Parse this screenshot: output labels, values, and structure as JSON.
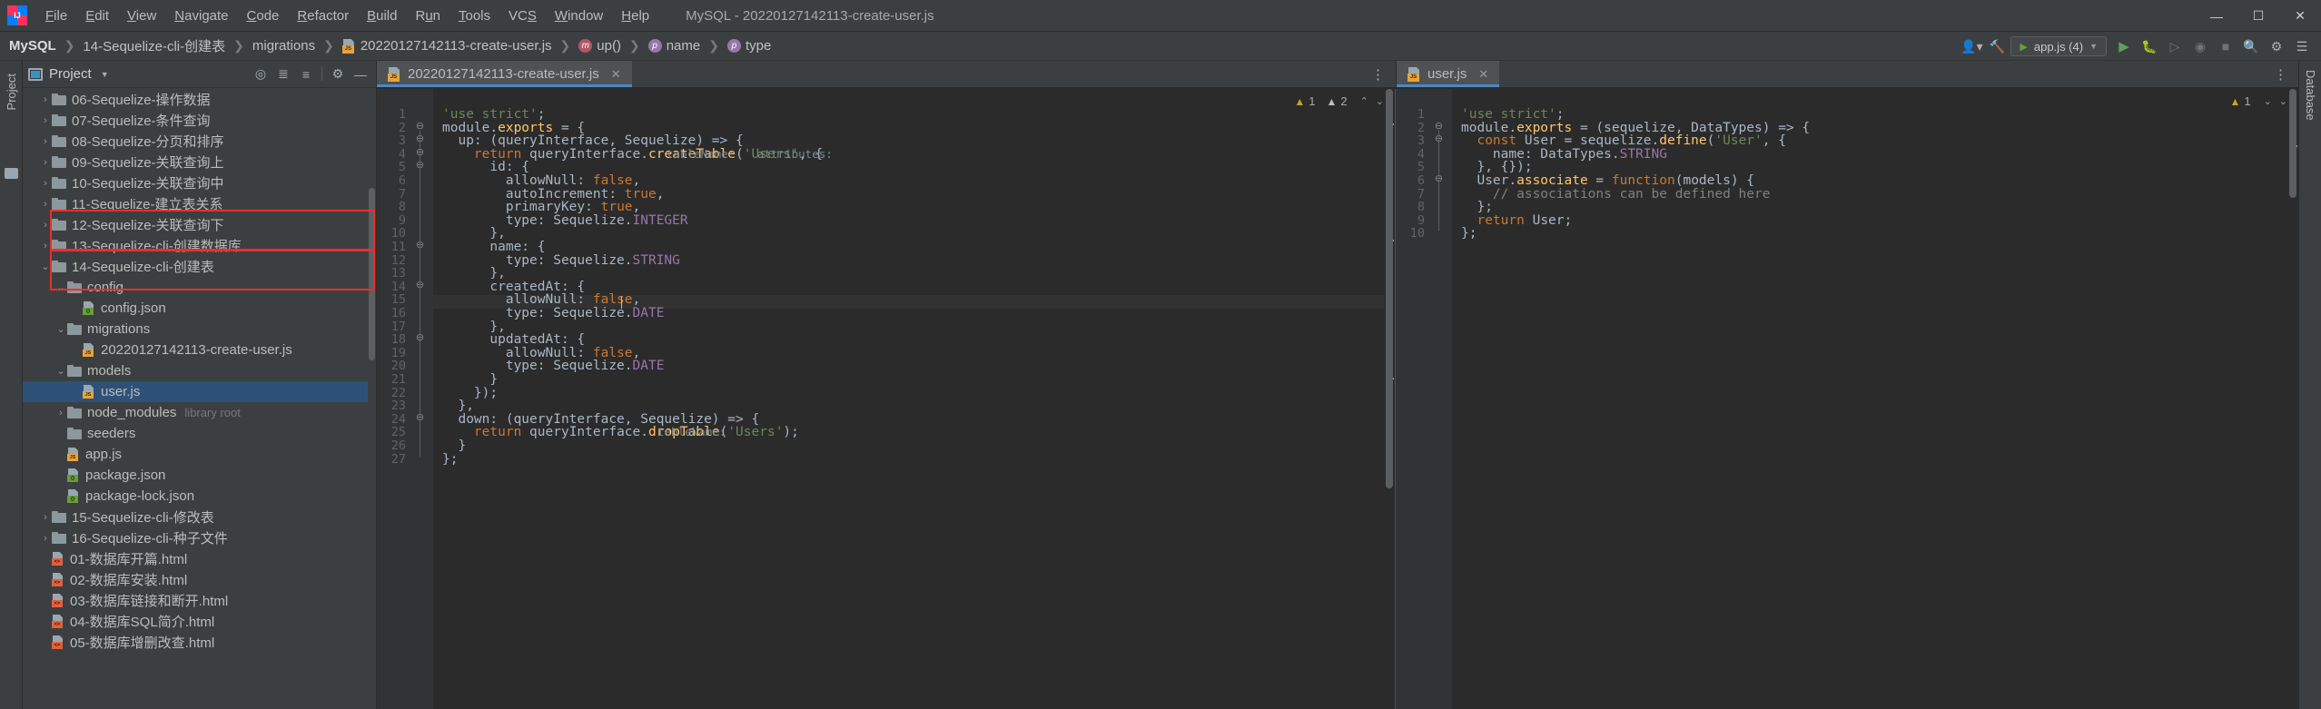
{
  "window": {
    "title": "MySQL - 20220127142113-create-user.js",
    "minimize": "—",
    "maximize": "☐",
    "close": "✕"
  },
  "menubar": {
    "logo_text": "IJ",
    "items": [
      {
        "pre": "",
        "mn": "F",
        "post": "ile"
      },
      {
        "pre": "",
        "mn": "E",
        "post": "dit"
      },
      {
        "pre": "",
        "mn": "V",
        "post": "iew"
      },
      {
        "pre": "",
        "mn": "N",
        "post": "avigate"
      },
      {
        "pre": "",
        "mn": "C",
        "post": "ode"
      },
      {
        "pre": "",
        "mn": "R",
        "post": "efactor"
      },
      {
        "pre": "",
        "mn": "B",
        "post": "uild"
      },
      {
        "pre": "R",
        "mn": "u",
        "post": "n"
      },
      {
        "pre": "",
        "mn": "T",
        "post": "ools"
      },
      {
        "pre": "VC",
        "mn": "S",
        "post": ""
      },
      {
        "pre": "",
        "mn": "W",
        "post": "indow"
      },
      {
        "pre": "",
        "mn": "H",
        "post": "elp"
      }
    ]
  },
  "breadcrumb": {
    "separator": "❯",
    "items": [
      {
        "label": "MySQL",
        "icon": "none",
        "root": true
      },
      {
        "label": "14-Sequelize-cli-创建表",
        "icon": "none"
      },
      {
        "label": "migrations",
        "icon": "none"
      },
      {
        "label": "20220127142113-create-user.js",
        "icon": "js-file-icon",
        "badge": "JS"
      },
      {
        "label": "up()",
        "icon": "method-icon",
        "badge": "m"
      },
      {
        "label": "name",
        "icon": "property-icon",
        "badge": "p"
      },
      {
        "label": "type",
        "icon": "property-icon",
        "badge": "p"
      }
    ]
  },
  "nav_right": {
    "run_config": "app.js (4)",
    "icons": [
      "user-icon",
      "hammer-icon",
      "run-icon",
      "debug-icon",
      "coverage-icon",
      "profile-icon",
      "stop-icon",
      "search-everywhere-icon",
      "settings-icon",
      "notifications-icon"
    ]
  },
  "left_strip": {
    "project_label": "Project",
    "structure_icon": "folder-icon"
  },
  "right_strip": {
    "database_label": "Database"
  },
  "project_panel": {
    "title": "Project",
    "toolbar_icons": [
      "locate-icon",
      "expand-all-icon",
      "collapse-all-icon",
      "settings-gear-icon",
      "hide-icon"
    ],
    "tree": [
      {
        "indent": 0,
        "arrow": "›",
        "icon": "folder",
        "label": "06-Sequelize-操作数据"
      },
      {
        "indent": 0,
        "arrow": "›",
        "icon": "folder",
        "label": "07-Sequelize-条件查询"
      },
      {
        "indent": 0,
        "arrow": "›",
        "icon": "folder",
        "label": "08-Sequelize-分页和排序"
      },
      {
        "indent": 0,
        "arrow": "›",
        "icon": "folder",
        "label": "09-Sequelize-关联查询上"
      },
      {
        "indent": 0,
        "arrow": "›",
        "icon": "folder",
        "label": "10-Sequelize-关联查询中"
      },
      {
        "indent": 0,
        "arrow": "›",
        "icon": "folder",
        "label": "11-Sequelize-建立表关系"
      },
      {
        "indent": 0,
        "arrow": "›",
        "icon": "folder",
        "label": "12-Sequelize-关联查询下"
      },
      {
        "indent": 0,
        "arrow": "›",
        "icon": "folder",
        "label": "13-Sequelize-cli-创建数据库"
      },
      {
        "indent": 0,
        "arrow": "⌄",
        "icon": "folder",
        "label": "14-Sequelize-cli-创建表"
      },
      {
        "indent": 1,
        "arrow": "⌄",
        "icon": "folder",
        "label": "config"
      },
      {
        "indent": 2,
        "arrow": "",
        "icon": "json",
        "label": "config.json"
      },
      {
        "indent": 1,
        "arrow": "⌄",
        "icon": "folder",
        "label": "migrations"
      },
      {
        "indent": 2,
        "arrow": "",
        "icon": "js",
        "label": "20220127142113-create-user.js"
      },
      {
        "indent": 1,
        "arrow": "⌄",
        "icon": "folder",
        "label": "models"
      },
      {
        "indent": 2,
        "arrow": "",
        "icon": "js",
        "label": "user.js",
        "selected": true
      },
      {
        "indent": 1,
        "arrow": "›",
        "icon": "folder",
        "label": "node_modules",
        "suffix": "library root"
      },
      {
        "indent": 1,
        "arrow": "",
        "icon": "folder",
        "label": "seeders"
      },
      {
        "indent": 1,
        "arrow": "",
        "icon": "js",
        "label": "app.js"
      },
      {
        "indent": 1,
        "arrow": "",
        "icon": "json",
        "label": "package.json"
      },
      {
        "indent": 1,
        "arrow": "",
        "icon": "json",
        "label": "package-lock.json"
      },
      {
        "indent": 0,
        "arrow": "›",
        "icon": "folder",
        "label": "15-Sequelize-cli-修改表"
      },
      {
        "indent": 0,
        "arrow": "›",
        "icon": "folder",
        "label": "16-Sequelize-cli-种子文件"
      },
      {
        "indent": 0,
        "arrow": "",
        "icon": "html",
        "label": "01-数据库开篇.html"
      },
      {
        "indent": 0,
        "arrow": "",
        "icon": "html",
        "label": "02-数据库安装.html"
      },
      {
        "indent": 0,
        "arrow": "",
        "icon": "html",
        "label": "03-数据库链接和断开.html"
      },
      {
        "indent": 0,
        "arrow": "",
        "icon": "html",
        "label": "04-数据库SQL简介.html"
      },
      {
        "indent": 0,
        "arrow": "",
        "icon": "html",
        "label": "05-数据库增删改查.html"
      }
    ],
    "annotations": [
      {
        "name": "migrations-highlight"
      },
      {
        "name": "models-highlight"
      }
    ]
  },
  "editor": {
    "tabs_left": [
      {
        "label": "20220127142113-create-user.js",
        "icon": "js-file-icon",
        "active": true,
        "close": "✕"
      }
    ],
    "tabs_right": [
      {
        "label": "user.js",
        "icon": "js-file-icon",
        "active": true,
        "close": "✕"
      }
    ],
    "tab_overflow": "⋮",
    "left_inspection": {
      "warnings": "1",
      "weak_warnings": "2",
      "up": "⌃",
      "down": "⌄"
    },
    "right_inspection": {
      "warnings": "1",
      "down": "⌄",
      "caret": "⌄"
    },
    "left_file": {
      "name": "20220127142113-create-user.js",
      "line_count": 27,
      "lines": [
        {
          "n": 1,
          "text": "'use strict';"
        },
        {
          "n": 2,
          "text": "module.exports = {"
        },
        {
          "n": 3,
          "text": "  up: (queryInterface, Sequelize) => {"
        },
        {
          "n": 4,
          "text": "    return queryInterface.createTable('Users', {"
        },
        {
          "n": 5,
          "text": "      id: {"
        },
        {
          "n": 6,
          "text": "        allowNull: false,"
        },
        {
          "n": 7,
          "text": "        autoIncrement: true,"
        },
        {
          "n": 8,
          "text": "        primaryKey: true,"
        },
        {
          "n": 9,
          "text": "        type: Sequelize.INTEGER"
        },
        {
          "n": 10,
          "text": "      },"
        },
        {
          "n": 11,
          "text": "      name: {"
        },
        {
          "n": 12,
          "text": "        type: Sequelize.STRING"
        },
        {
          "n": 13,
          "text": "      },"
        },
        {
          "n": 14,
          "text": "      createdAt: {"
        },
        {
          "n": 15,
          "text": "        allowNull: false,"
        },
        {
          "n": 16,
          "text": "        type: Sequelize.DATE"
        },
        {
          "n": 17,
          "text": "      },"
        },
        {
          "n": 18,
          "text": "      updatedAt: {"
        },
        {
          "n": 19,
          "text": "        allowNull: false,"
        },
        {
          "n": 20,
          "text": "        type: Sequelize.DATE"
        },
        {
          "n": 21,
          "text": "      }"
        },
        {
          "n": 22,
          "text": "    });"
        },
        {
          "n": 23,
          "text": "  },"
        },
        {
          "n": 24,
          "text": "  down: (queryInterface, Sequelize) => {"
        },
        {
          "n": 25,
          "text": "    return queryInterface.dropTable('Users');"
        },
        {
          "n": 26,
          "text": "  }"
        },
        {
          "n": 27,
          "text": "};"
        }
      ],
      "param_hints": [
        "tableName:",
        "attributes:",
        "tableName:"
      ],
      "cursor_line": 12
    },
    "right_file": {
      "name": "user.js",
      "line_count": 10,
      "lines": [
        {
          "n": 1,
          "text": "'use strict';"
        },
        {
          "n": 2,
          "text": "module.exports = (sequelize, DataTypes) => {"
        },
        {
          "n": 3,
          "text": "  const User = sequelize.define('User', {"
        },
        {
          "n": 4,
          "text": "    name: DataTypes.STRING"
        },
        {
          "n": 5,
          "text": "  }, {});"
        },
        {
          "n": 6,
          "text": "  User.associate = function(models) {"
        },
        {
          "n": 7,
          "text": "    // associations can be defined here"
        },
        {
          "n": 8,
          "text": "  };"
        },
        {
          "n": 9,
          "text": "  return User;"
        },
        {
          "n": 10,
          "text": "};"
        }
      ]
    }
  },
  "colors": {
    "bg_editor": "#2b2b2b",
    "bg_panel": "#3c3f41",
    "accent_tab": "#4a88c7",
    "selection": "#2d5177",
    "annotation": "#ec2d2d",
    "string": "#6a8759",
    "keyword": "#cc7832",
    "function": "#ffc66d",
    "property": "#9876aa",
    "number": "#6897bb",
    "comment": "#808080"
  }
}
